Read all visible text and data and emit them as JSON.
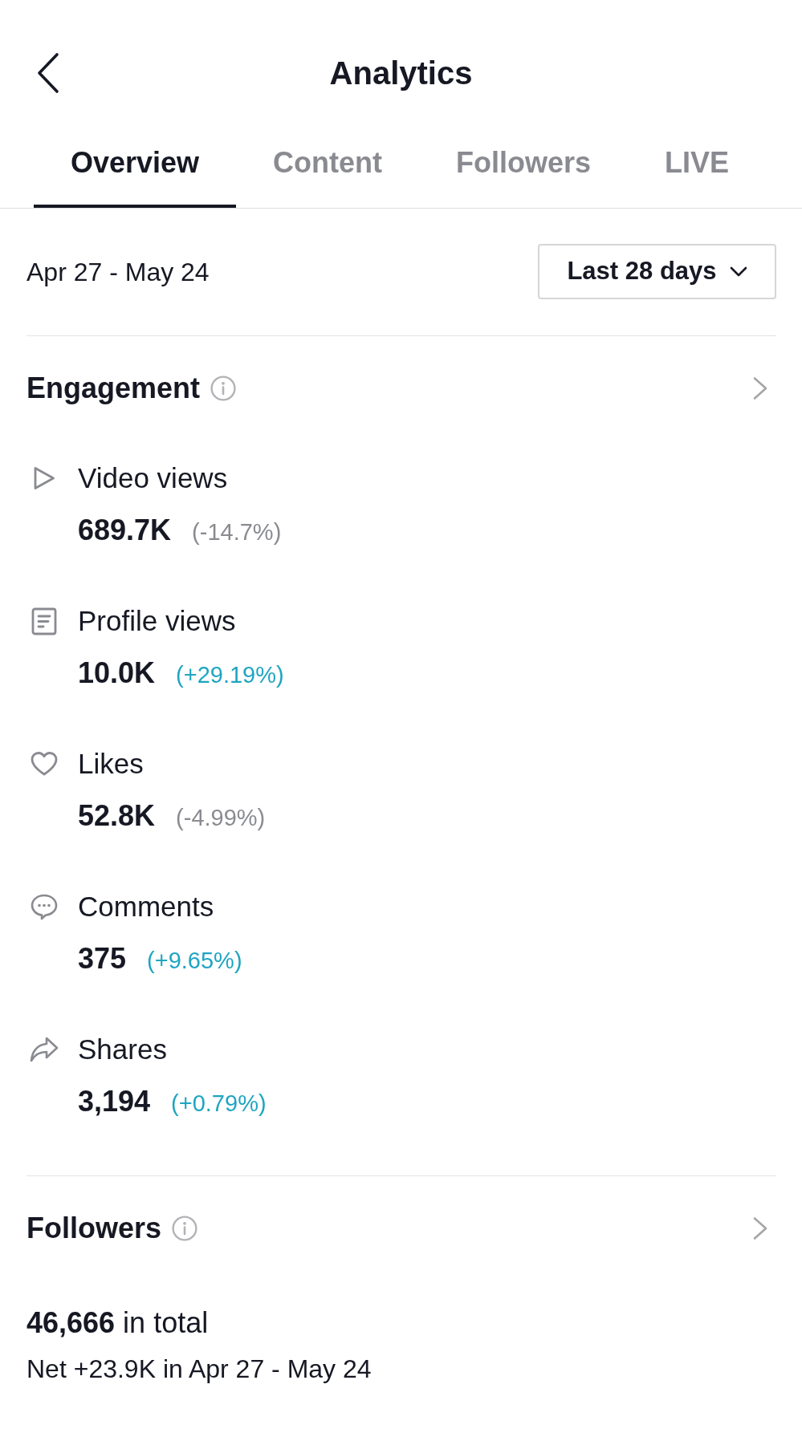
{
  "header": {
    "title": "Analytics"
  },
  "tabs": [
    {
      "label": "Overview",
      "selected": true
    },
    {
      "label": "Content",
      "selected": false
    },
    {
      "label": "Followers",
      "selected": false
    },
    {
      "label": "LIVE",
      "selected": false
    }
  ],
  "date_range": {
    "label": "Apr 27 - May 24",
    "period": "Last 28 days"
  },
  "engagement": {
    "title": "Engagement",
    "metrics": [
      {
        "kind": "play",
        "label": "Video views",
        "value": "689.7K",
        "change": "(-14.7%)",
        "positive": false
      },
      {
        "kind": "document",
        "label": "Profile views",
        "value": "10.0K",
        "change": "(+29.19%)",
        "positive": true
      },
      {
        "kind": "heart",
        "label": "Likes",
        "value": "52.8K",
        "change": "(-4.99%)",
        "positive": false
      },
      {
        "kind": "comment",
        "label": "Comments",
        "value": "375",
        "change": "(+9.65%)",
        "positive": true
      },
      {
        "kind": "share",
        "label": "Shares",
        "value": "3,194",
        "change": "(+0.79%)",
        "positive": true
      }
    ]
  },
  "followers": {
    "title": "Followers",
    "total": "**46,666** in total",
    "net": "Net +23.9K in Apr 27 - May 24"
  }
}
